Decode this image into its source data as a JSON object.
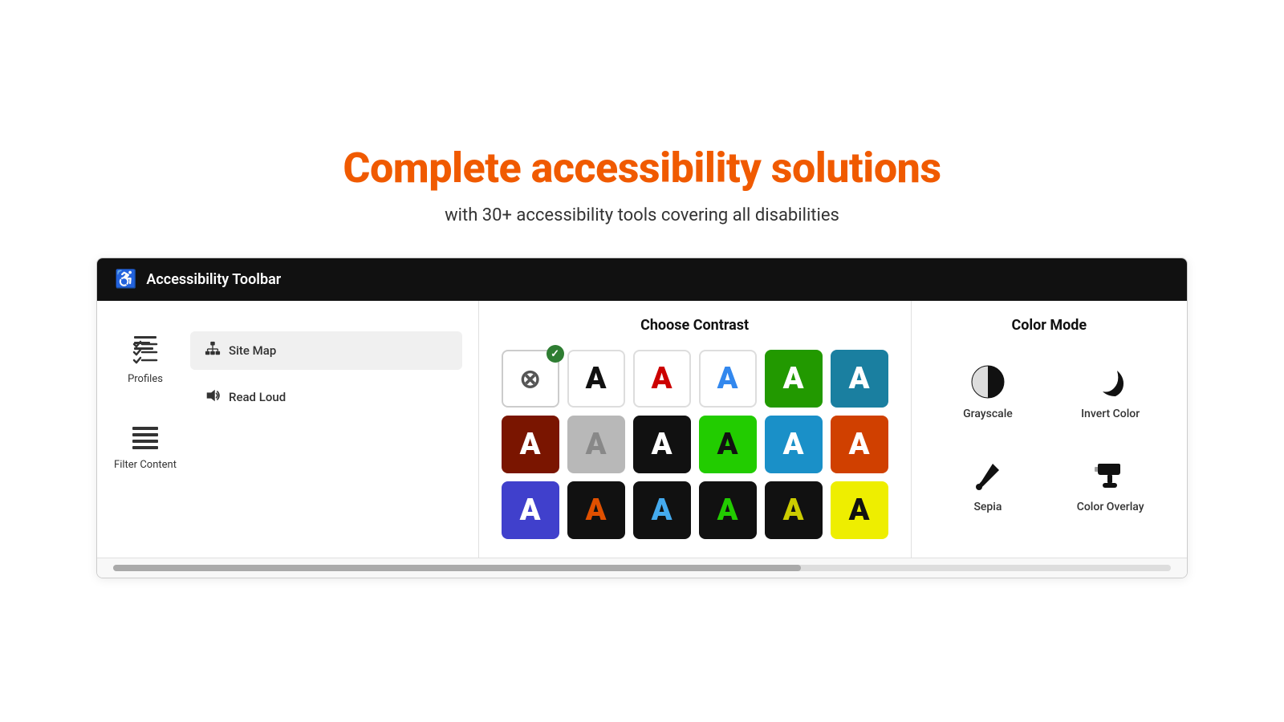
{
  "header": {
    "main_title": "Complete accessibility solutions",
    "subtitle": "with 30+ accessibility tools covering all disabilities"
  },
  "toolbar": {
    "header_label": "Accessibility Toolbar",
    "left_panel": {
      "icons": [
        {
          "id": "profiles",
          "label": "Profiles",
          "icon": "profiles"
        },
        {
          "id": "filter",
          "label": "Filter Content",
          "icon": "filter"
        }
      ],
      "menu_items": [
        {
          "id": "site-map",
          "label": "Site Map",
          "icon": "sitemap",
          "active": true
        },
        {
          "id": "read-loud",
          "label": "Read Loud",
          "icon": "speaker",
          "active": false
        }
      ]
    },
    "center_panel": {
      "title": "Choose Contrast",
      "rows": [
        [
          {
            "label": "A",
            "style": "r1-default",
            "has_check": true,
            "has_x": true
          },
          {
            "label": "A",
            "style": "r1-dark"
          },
          {
            "label": "A",
            "style": "r1-red"
          },
          {
            "label": "A",
            "style": "r1-blue"
          },
          {
            "label": "A",
            "style": "r1-green-bg"
          },
          {
            "label": "A",
            "style": "r1-teal-bg"
          }
        ],
        [
          {
            "label": "A",
            "style": "r2-red-bg"
          },
          {
            "label": "A",
            "style": "r2-gray-bg"
          },
          {
            "label": "A",
            "style": "r2-black-bg"
          },
          {
            "label": "A",
            "style": "r2-green-bg2"
          },
          {
            "label": "A",
            "style": "r2-blue-bg2"
          },
          {
            "label": "A",
            "style": "r2-orange-bg"
          }
        ],
        [
          {
            "label": "A",
            "style": "r3-blue-bg3"
          },
          {
            "label": "A",
            "style": "r3-black-orange"
          },
          {
            "label": "A",
            "style": "r3-black-blue"
          },
          {
            "label": "A",
            "style": "r3-black-green"
          },
          {
            "label": "A",
            "style": "r3-black-yellow"
          },
          {
            "label": "A",
            "style": "r3-yellow-black"
          }
        ]
      ]
    },
    "right_panel": {
      "title": "Color Mode",
      "items": [
        {
          "id": "grayscale",
          "label": "Grayscale",
          "icon": "grayscale"
        },
        {
          "id": "invert-color",
          "label": "Invert Color",
          "icon": "invert"
        },
        {
          "id": "sepia",
          "label": "Sepia",
          "icon": "sepia"
        },
        {
          "id": "color-overlay",
          "label": "Color Overlay",
          "icon": "overlay"
        }
      ]
    }
  }
}
